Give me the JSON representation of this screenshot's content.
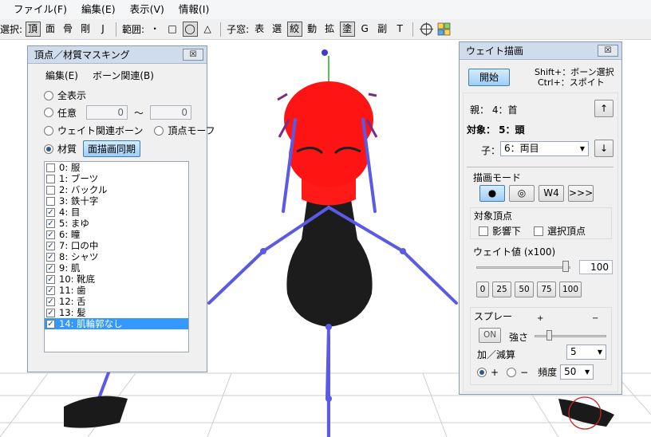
{
  "menu": [
    "ファイル(F)",
    "編集(E)",
    "表示(V)",
    "情報(I)"
  ],
  "toolbar": {
    "select_label": "選択:",
    "select_items": [
      "頂",
      "面",
      "骨",
      "剛",
      "J"
    ],
    "range_label": "範囲:",
    "range_items": [
      "・",
      "□",
      "◯",
      "△"
    ],
    "child_label": "子窓:",
    "child_items": [
      "表",
      "選",
      "絞",
      "動",
      "拡",
      "塗",
      "G",
      "副",
      "T"
    ],
    "active": [
      "頂",
      "◯",
      "絞",
      "塗"
    ]
  },
  "mask_panel": {
    "title": "頂点／材質マスキング",
    "close": "☒",
    "menu_edit": "編集(E)",
    "menu_bone": "ボーン関連(B)",
    "opt_all": "全表示",
    "opt_any": "任意",
    "any_from": "0",
    "tilde": "〜",
    "any_to": "0",
    "opt_weight_bone": "ウェイト関連ボーン",
    "opt_vertex_morph": "頂点モーフ",
    "opt_material": "材質",
    "sync_button": "面描画同期",
    "materials": [
      {
        "label": "0: 服",
        "checked": false
      },
      {
        "label": "1: ブーツ",
        "checked": false
      },
      {
        "label": "2: バックル",
        "checked": false
      },
      {
        "label": "3: 鉄十字",
        "checked": false
      },
      {
        "label": "4: 目",
        "checked": true
      },
      {
        "label": "5: まゆ",
        "checked": true
      },
      {
        "label": "6: 瞳",
        "checked": true
      },
      {
        "label": "7: 口の中",
        "checked": true
      },
      {
        "label": "8: シャツ",
        "checked": true
      },
      {
        "label": "9: 肌",
        "checked": true
      },
      {
        "label": "10: 靴底",
        "checked": true
      },
      {
        "label": "11: 歯",
        "checked": true
      },
      {
        "label": "12: 舌",
        "checked": true
      },
      {
        "label": "13: 髪",
        "checked": true
      },
      {
        "label": "14: 肌輪郭なし",
        "checked": true,
        "selected": true
      }
    ]
  },
  "weight_panel": {
    "title": "ウェイト描画",
    "close": "☒",
    "start_button": "開始",
    "hint_line1": "Shift+：ボーン選択",
    "hint_line2": "Ctrl+：スポイト",
    "parent": "親：  4：首",
    "target": "対象：  5：頭",
    "child_label": "子：",
    "child_value": "6：両目",
    "up_arrow": "↑",
    "down_arrow": "↓",
    "draw_mode_label": "描画モード",
    "mode_buttons": [
      "●",
      "◎",
      "W4",
      ">>>"
    ],
    "target_vertex_label": "対象頂点",
    "influence_label": "影響下",
    "selected_vertex_label": "選択頂点",
    "weight_label": "ウェイト値 (x100)",
    "weight_value": "100",
    "weight_level": 1.0,
    "weight_presets": [
      "0",
      "25",
      "50",
      "75",
      "100"
    ],
    "spray_label": "スプレー",
    "spray_plus": "+",
    "spray_minus": "−",
    "on_button": "ON",
    "strength_label": "強さ",
    "strength_value": "5",
    "addsub_label": "加／減算",
    "add_label": "+",
    "sub_label": "−",
    "frequency_label": "頻度",
    "frequency_value": "50"
  },
  "colors": {
    "bone": "#5a5ae6",
    "vertex_highlight": "#ff0000",
    "body": "#1a1a1a",
    "panel_title": "#cfdcec",
    "selection": "#3399ff"
  }
}
